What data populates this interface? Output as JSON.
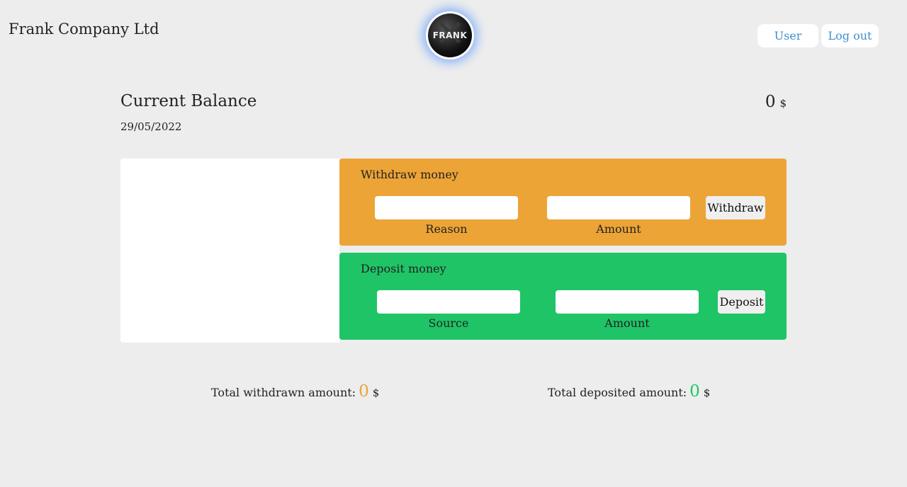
{
  "header": {
    "brand": "Frank Company Ltd",
    "logo_text": "FRANK",
    "user_label": "User",
    "logout_label": "Log out"
  },
  "balance": {
    "title": "Current Balance",
    "date": "29/05/2022",
    "value": "0",
    "currency": "$"
  },
  "withdraw": {
    "title": "Withdraw money",
    "reason_label": "Reason",
    "reason_value": "",
    "amount_label": "Amount",
    "amount_value": "",
    "button_label": "Withdraw"
  },
  "deposit": {
    "title": "Deposit money",
    "source_label": "Source",
    "source_value": "",
    "amount_label": "Amount",
    "amount_value": "",
    "button_label": "Deposit"
  },
  "totals": {
    "withdrawn_label": "Total withdrawn amount:",
    "withdrawn_value": "0",
    "deposited_label": "Total deposited amount:",
    "deposited_value": "0",
    "currency": "$"
  },
  "colors": {
    "withdraw_accent": "#eca436",
    "deposit_accent": "#1fc467",
    "link": "#3d8fcc"
  }
}
